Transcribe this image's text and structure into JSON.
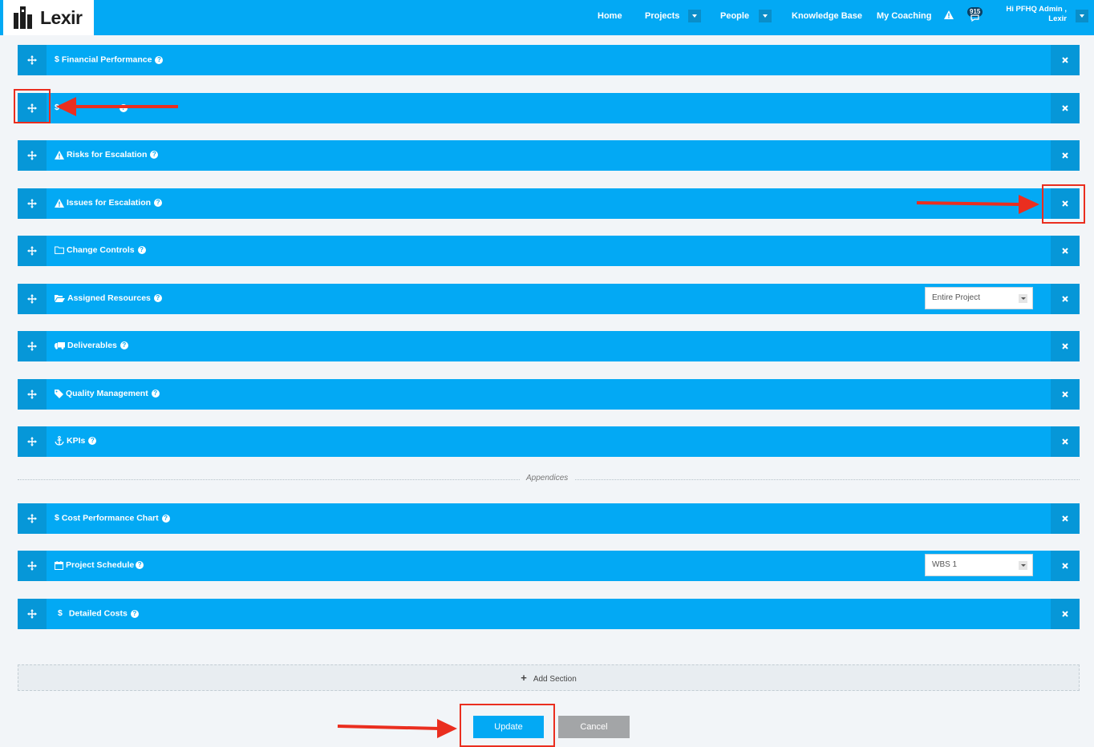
{
  "brand": {
    "name": "Lexir"
  },
  "nav": {
    "home": "Home",
    "projects": "Projects",
    "people": "People",
    "knowledge_base": "Knowledge Base",
    "my_coaching": "My Coaching",
    "notification_count": "915",
    "user_greeting": "Hi PFHQ Admin ,",
    "user_org": "Lexir"
  },
  "sections": [
    {
      "label": "Financial Performance",
      "icon": "dollar-icon"
    },
    {
      "label": "",
      "icon": "dollar-icon"
    },
    {
      "label": "Risks for Escalation",
      "icon": "warning-icon"
    },
    {
      "label": "Issues for Escalation",
      "icon": "warning-icon"
    },
    {
      "label": "Change Controls",
      "icon": "folder-icon"
    },
    {
      "label": "Assigned Resources",
      "icon": "folder-open-icon",
      "select_value": "Entire Project"
    },
    {
      "label": "Deliverables",
      "icon": "truck-icon"
    },
    {
      "label": "Quality Management",
      "icon": "tag-icon"
    },
    {
      "label": "KPIs",
      "icon": "anchor-icon"
    }
  ],
  "appendices_label": "Appendices",
  "appendices": [
    {
      "label": "Cost Performance Chart",
      "icon": "dollar-icon"
    },
    {
      "label": "Project Schedule",
      "icon": "calendar-icon",
      "select_value": "WBS 1"
    },
    {
      "label": "Detailed Costs",
      "icon": "dollar-icon"
    }
  ],
  "add_section_label": "Add Section",
  "buttons": {
    "update": "Update",
    "cancel": "Cancel"
  },
  "colors": {
    "primary": "#03a9f4",
    "dark": "#0697d8",
    "annotation": "#ea2e1f",
    "cancel": "#a3a5a7"
  }
}
